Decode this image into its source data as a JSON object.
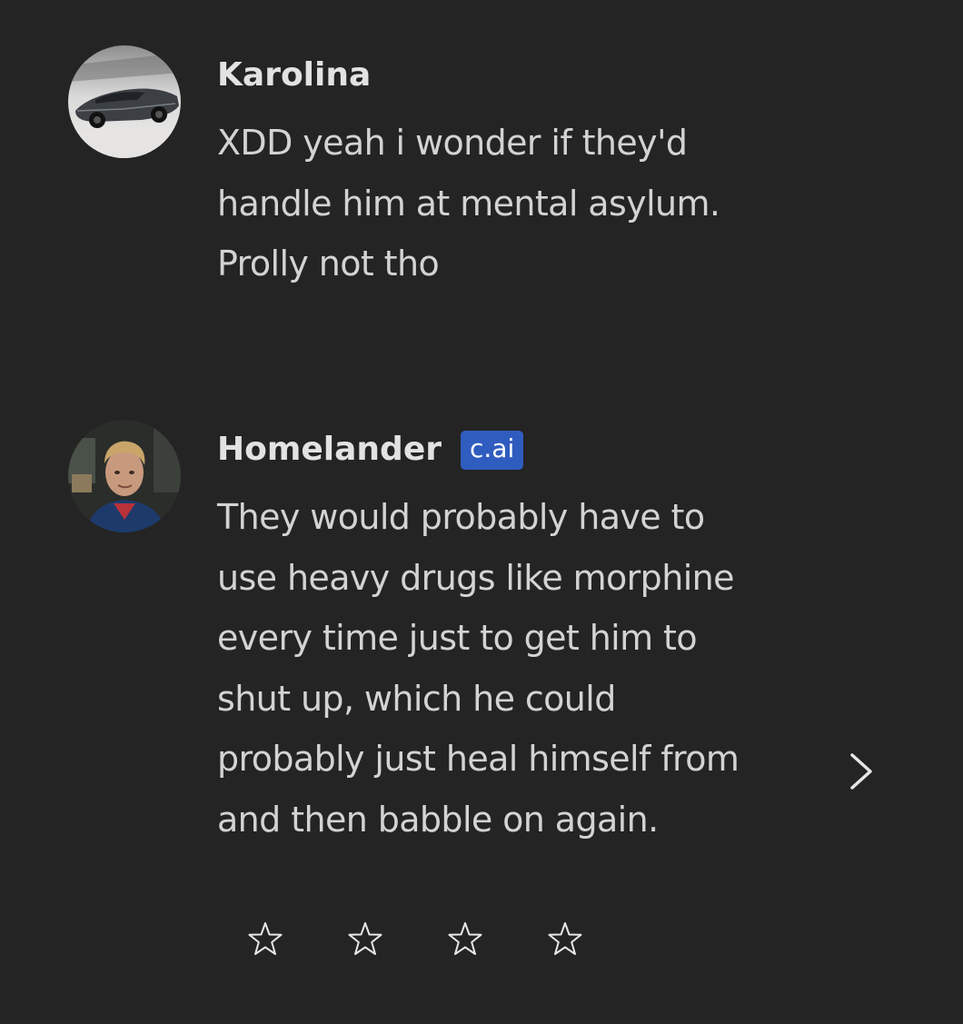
{
  "messages": [
    {
      "author": "Karolina",
      "badge": "",
      "text": "XDD yeah i wonder if they'd\nhandle him at mental asylum.\nProlly not tho",
      "avatar_icon": "car-avatar-icon"
    },
    {
      "author": "Homelander",
      "badge": "c.ai",
      "text": "They would probably have to\nuse heavy drugs like morphine\nevery time just to get him to\nshut up, which he could\nprobably just heal himself from\nand then babble on again.",
      "avatar_icon": "person-avatar-icon"
    }
  ],
  "navigation": {
    "next_icon": "chevron-right-icon"
  },
  "rating": {
    "icon": "star-outline-icon",
    "count": 4,
    "selected": 0
  },
  "colors": {
    "background": "#242424",
    "text": "#d3d3d3",
    "author": "#e2e2e2",
    "badge_bg": "#2f5cbf"
  }
}
